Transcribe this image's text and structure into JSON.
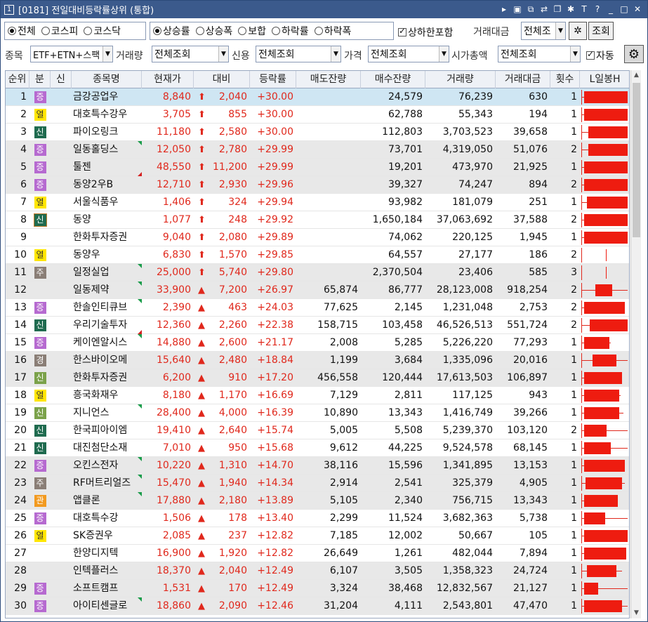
{
  "window": {
    "number": "1",
    "title": "[0181] 전일대비등락률상위 (통합)"
  },
  "market_radios": [
    {
      "label": "전체",
      "selected": true
    },
    {
      "label": "코스피",
      "selected": false
    },
    {
      "label": "코스닥",
      "selected": false
    }
  ],
  "sort_radios": [
    {
      "label": "상승률",
      "selected": true
    },
    {
      "label": "상승폭",
      "selected": false
    },
    {
      "label": "보합",
      "selected": false
    },
    {
      "label": "하락률",
      "selected": false
    },
    {
      "label": "하락폭",
      "selected": false
    }
  ],
  "include_limit": {
    "label": "상하한포함",
    "checked": true
  },
  "trade_amount": {
    "label": "거래대금",
    "value": "전체조"
  },
  "query_button": "조회",
  "filters": {
    "stock_label": "종목",
    "stock_value": "ETF+ETN+스팩",
    "volume_label": "거래량",
    "volume_value": "전체조회",
    "credit_label": "신용",
    "credit_value": "전체조회",
    "price_label": "가격",
    "price_value": "전체조회",
    "mcap_label": "시가총액",
    "mcap_value": "전체조회",
    "auto_label": "자동",
    "auto_checked": true
  },
  "columns": [
    "순위",
    "분",
    "신",
    "종목명",
    "현재가",
    "대비",
    "등락률",
    "매도잔량",
    "매수잔량",
    "거래량",
    "거래대금",
    "횟수",
    "L일봉H"
  ],
  "colors": {
    "up": "#e0281c",
    "title_bar": "#3b5a8c",
    "selected_row": "#cfe6f3",
    "alt_row": "#e8e8e8"
  },
  "rows": [
    {
      "rank": "1",
      "tag": "증",
      "tagc": "purple",
      "name": "금강공업우",
      "price": "8,840",
      "arrow": "up-arrow",
      "diff": "2,040",
      "rate": "+30.00",
      "ask": "",
      "bid": "24,579",
      "vol": "76,239",
      "amt": "630",
      "cnt": "1",
      "mk": ""
    },
    {
      "rank": "2",
      "tag": "열",
      "tagc": "yellow",
      "name": "대호특수강우",
      "price": "3,705",
      "arrow": "up-arrow",
      "diff": "855",
      "rate": "+30.00",
      "ask": "",
      "bid": "62,788",
      "vol": "55,343",
      "amt": "194",
      "cnt": "1",
      "mk": ""
    },
    {
      "rank": "3",
      "tag": "신",
      "tagc": "green",
      "name": "파이오링크",
      "price": "11,180",
      "arrow": "up-arrow",
      "diff": "2,580",
      "rate": "+30.00",
      "ask": "",
      "bid": "112,803",
      "vol": "3,703,523",
      "amt": "39,658",
      "cnt": "1",
      "mk": ""
    },
    {
      "rank": "4",
      "tag": "증",
      "tagc": "purple",
      "name": "일동홀딩스",
      "price": "12,050",
      "arrow": "up-arrow",
      "diff": "2,780",
      "rate": "+29.99",
      "ask": "",
      "bid": "73,701",
      "vol": "4,319,050",
      "amt": "51,076",
      "cnt": "2",
      "mk": "tr"
    },
    {
      "rank": "5",
      "tag": "증",
      "tagc": "purple",
      "name": "툴젠",
      "price": "48,550",
      "arrow": "up-arrow",
      "diff": "11,200",
      "rate": "+29.99",
      "ask": "",
      "bid": "19,201",
      "vol": "473,970",
      "amt": "21,925",
      "cnt": "1",
      "mk": "br"
    },
    {
      "rank": "6",
      "tag": "증",
      "tagc": "purple",
      "name": "동양2우B",
      "price": "12,710",
      "arrow": "up-arrow",
      "diff": "2,930",
      "rate": "+29.96",
      "ask": "",
      "bid": "39,327",
      "vol": "74,247",
      "amt": "894",
      "cnt": "2",
      "mk": ""
    },
    {
      "rank": "7",
      "tag": "열",
      "tagc": "yellow",
      "name": "서울식품우",
      "price": "1,406",
      "arrow": "up-arrow",
      "diff": "324",
      "rate": "+29.94",
      "ask": "",
      "bid": "93,982",
      "vol": "181,079",
      "amt": "251",
      "cnt": "1",
      "mk": ""
    },
    {
      "rank": "8",
      "tag": "신",
      "tagc": "green2",
      "name": "동양",
      "price": "1,077",
      "arrow": "up-arrow",
      "diff": "248",
      "rate": "+29.92",
      "ask": "",
      "bid": "1,650,184",
      "vol": "37,063,692",
      "amt": "37,588",
      "cnt": "2",
      "mk": ""
    },
    {
      "rank": "9",
      "tag": "",
      "tagc": "",
      "name": "한화투자증권",
      "price": "9,040",
      "arrow": "up-arrow",
      "diff": "2,080",
      "rate": "+29.89",
      "ask": "",
      "bid": "74,062",
      "vol": "220,125",
      "amt": "1,945",
      "cnt": "1",
      "mk": ""
    },
    {
      "rank": "10",
      "tag": "열",
      "tagc": "yellow",
      "name": "동양우",
      "price": "6,830",
      "arrow": "up-arrow",
      "diff": "1,570",
      "rate": "+29.85",
      "ask": "",
      "bid": "64,557",
      "vol": "27,177",
      "amt": "186",
      "cnt": "2",
      "mk": ""
    },
    {
      "rank": "11",
      "tag": "주",
      "tagc": "gray",
      "name": "일정실업",
      "price": "25,000",
      "arrow": "up-arrow",
      "diff": "5,740",
      "rate": "+29.80",
      "ask": "",
      "bid": "2,370,504",
      "vol": "23,406",
      "amt": "585",
      "cnt": "3",
      "mk": "tr"
    },
    {
      "rank": "12",
      "tag": "",
      "tagc": "",
      "name": "일동제약",
      "price": "33,900",
      "arrow": "up-triangle",
      "diff": "7,200",
      "rate": "+26.97",
      "ask": "65,874",
      "bid": "86,777",
      "vol": "28,123,008",
      "amt": "918,254",
      "cnt": "2",
      "mk": "tr"
    },
    {
      "rank": "13",
      "tag": "증",
      "tagc": "purple",
      "name": "한솔인티큐브",
      "price": "2,390",
      "arrow": "up-triangle",
      "diff": "463",
      "rate": "+24.03",
      "ask": "77,625",
      "bid": "2,145",
      "vol": "1,231,048",
      "amt": "2,753",
      "cnt": "2",
      "mk": "tr"
    },
    {
      "rank": "14",
      "tag": "신",
      "tagc": "green",
      "name": "우리기술투자",
      "price": "12,360",
      "arrow": "up-triangle",
      "diff": "2,260",
      "rate": "+22.38",
      "ask": "158,715",
      "bid": "103,458",
      "vol": "46,526,513",
      "amt": "551,724",
      "cnt": "2",
      "mk": "br"
    },
    {
      "rank": "15",
      "tag": "증",
      "tagc": "purple",
      "name": "케이엔알시스",
      "price": "14,880",
      "arrow": "up-triangle",
      "diff": "2,600",
      "rate": "+21.17",
      "ask": "2,008",
      "bid": "5,285",
      "vol": "5,226,220",
      "amt": "77,293",
      "cnt": "1",
      "mk": "tr"
    },
    {
      "rank": "16",
      "tag": "경",
      "tagc": "gray",
      "name": "한스바이오메",
      "price": "15,640",
      "arrow": "up-triangle",
      "diff": "2,480",
      "rate": "+18.84",
      "ask": "1,199",
      "bid": "3,684",
      "vol": "1,335,096",
      "amt": "20,016",
      "cnt": "1",
      "mk": ""
    },
    {
      "rank": "17",
      "tag": "신",
      "tagc": "lgreen",
      "name": "한화투자증권",
      "price": "6,200",
      "arrow": "up-triangle",
      "diff": "910",
      "rate": "+17.20",
      "ask": "456,558",
      "bid": "120,444",
      "vol": "17,613,503",
      "amt": "106,897",
      "cnt": "1",
      "mk": ""
    },
    {
      "rank": "18",
      "tag": "열",
      "tagc": "yellow",
      "name": "흥국화재우",
      "price": "8,180",
      "arrow": "up-triangle",
      "diff": "1,170",
      "rate": "+16.69",
      "ask": "7,129",
      "bid": "2,811",
      "vol": "117,125",
      "amt": "943",
      "cnt": "1",
      "mk": ""
    },
    {
      "rank": "19",
      "tag": "신",
      "tagc": "lgreen",
      "name": "지니언스",
      "price": "28,400",
      "arrow": "up-triangle",
      "diff": "4,000",
      "rate": "+16.39",
      "ask": "10,890",
      "bid": "13,343",
      "vol": "1,416,749",
      "amt": "39,266",
      "cnt": "1",
      "mk": "tr"
    },
    {
      "rank": "20",
      "tag": "신",
      "tagc": "green",
      "name": "한국피아이엠",
      "price": "19,410",
      "arrow": "up-triangle",
      "diff": "2,640",
      "rate": "+15.74",
      "ask": "5,005",
      "bid": "5,508",
      "vol": "5,239,370",
      "amt": "103,120",
      "cnt": "2",
      "mk": ""
    },
    {
      "rank": "21",
      "tag": "신",
      "tagc": "green",
      "name": "대진첨단소재",
      "price": "7,010",
      "arrow": "up-triangle",
      "diff": "950",
      "rate": "+15.68",
      "ask": "9,612",
      "bid": "44,225",
      "vol": "9,524,578",
      "amt": "68,145",
      "cnt": "1",
      "mk": ""
    },
    {
      "rank": "22",
      "tag": "증",
      "tagc": "purple",
      "name": "오킨스전자",
      "price": "10,220",
      "arrow": "up-triangle",
      "diff": "1,310",
      "rate": "+14.70",
      "ask": "38,116",
      "bid": "15,596",
      "vol": "1,341,895",
      "amt": "13,153",
      "cnt": "1",
      "mk": "tr"
    },
    {
      "rank": "23",
      "tag": "주",
      "tagc": "gray",
      "name": "RF머트리얼즈",
      "price": "15,470",
      "arrow": "up-triangle",
      "diff": "1,940",
      "rate": "+14.34",
      "ask": "2,914",
      "bid": "2,541",
      "vol": "325,379",
      "amt": "4,905",
      "cnt": "1",
      "mk": "tr"
    },
    {
      "rank": "24",
      "tag": "관",
      "tagc": "orange",
      "name": "앱클론",
      "price": "17,880",
      "arrow": "up-triangle",
      "diff": "2,180",
      "rate": "+13.89",
      "ask": "5,105",
      "bid": "2,340",
      "vol": "756,715",
      "amt": "13,343",
      "cnt": "1",
      "mk": "tr"
    },
    {
      "rank": "25",
      "tag": "증",
      "tagc": "purple",
      "name": "대호특수강",
      "price": "1,506",
      "arrow": "up-triangle",
      "diff": "178",
      "rate": "+13.40",
      "ask": "2,299",
      "bid": "11,524",
      "vol": "3,682,363",
      "amt": "5,738",
      "cnt": "1",
      "mk": ""
    },
    {
      "rank": "26",
      "tag": "열",
      "tagc": "yellow",
      "name": "SK증권우",
      "price": "2,085",
      "arrow": "up-triangle",
      "diff": "237",
      "rate": "+12.82",
      "ask": "7,185",
      "bid": "12,002",
      "vol": "50,667",
      "amt": "105",
      "cnt": "1",
      "mk": ""
    },
    {
      "rank": "27",
      "tag": "",
      "tagc": "",
      "name": "한양디지텍",
      "price": "16,900",
      "arrow": "up-triangle",
      "diff": "1,920",
      "rate": "+12.82",
      "ask": "26,649",
      "bid": "1,261",
      "vol": "482,044",
      "amt": "7,894",
      "cnt": "1",
      "mk": ""
    },
    {
      "rank": "28",
      "tag": "",
      "tagc": "",
      "name": "인텍플러스",
      "price": "18,370",
      "arrow": "up-triangle",
      "diff": "2,040",
      "rate": "+12.49",
      "ask": "6,107",
      "bid": "3,505",
      "vol": "1,358,323",
      "amt": "24,724",
      "cnt": "1",
      "mk": ""
    },
    {
      "rank": "29",
      "tag": "증",
      "tagc": "purple",
      "name": "소프트캠프",
      "price": "1,531",
      "arrow": "up-triangle",
      "diff": "170",
      "rate": "+12.49",
      "ask": "3,324",
      "bid": "38,468",
      "vol": "12,832,567",
      "amt": "21,127",
      "cnt": "1",
      "mk": ""
    },
    {
      "rank": "30",
      "tag": "증",
      "tagc": "purple",
      "name": "아이티센글로",
      "price": "18,860",
      "arrow": "up-triangle",
      "diff": "2,090",
      "rate": "+12.46",
      "ask": "31,204",
      "bid": "4,111",
      "vol": "2,543,801",
      "amt": "47,470",
      "cnt": "1",
      "mk": "tr"
    }
  ]
}
